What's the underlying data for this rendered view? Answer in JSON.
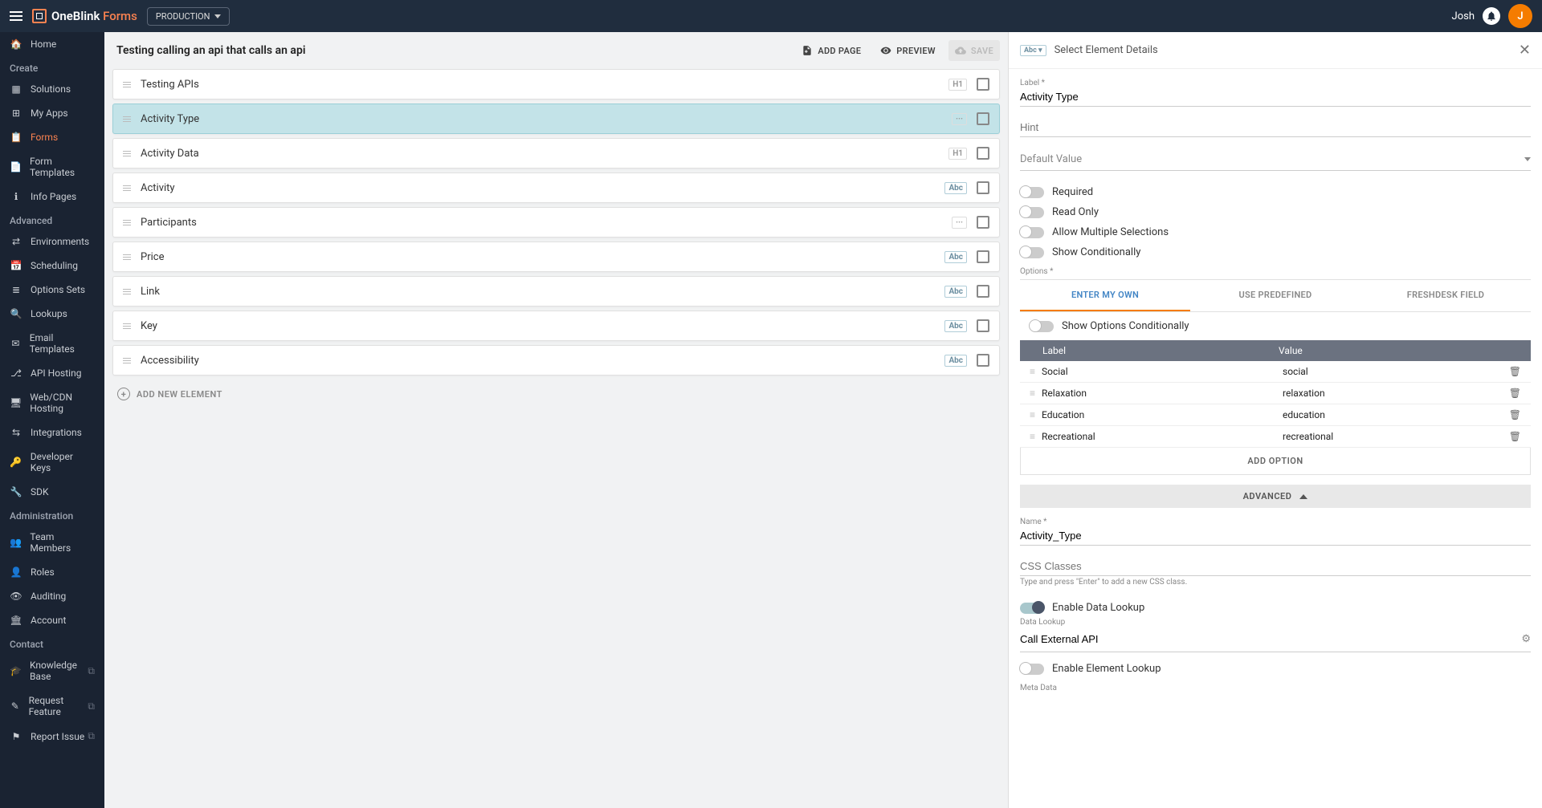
{
  "header": {
    "brand_one": "OneBlink",
    "brand_forms": "Forms",
    "env_btn": "PRODUCTION",
    "username": "Josh",
    "avatar_initial": "J"
  },
  "sidebar": {
    "home": "Home",
    "section_create": "Create",
    "create": [
      {
        "label": "Solutions"
      },
      {
        "label": "My Apps"
      },
      {
        "label": "Forms",
        "active": true
      },
      {
        "label": "Form Templates"
      },
      {
        "label": "Info Pages"
      }
    ],
    "section_advanced": "Advanced",
    "advanced": [
      {
        "label": "Environments"
      },
      {
        "label": "Scheduling"
      },
      {
        "label": "Options Sets"
      },
      {
        "label": "Lookups"
      },
      {
        "label": "Email Templates"
      },
      {
        "label": "API Hosting"
      },
      {
        "label": "Web/CDN Hosting"
      },
      {
        "label": "Integrations"
      },
      {
        "label": "Developer Keys"
      },
      {
        "label": "SDK"
      }
    ],
    "section_admin": "Administration",
    "admin": [
      {
        "label": "Team Members"
      },
      {
        "label": "Roles"
      },
      {
        "label": "Auditing"
      },
      {
        "label": "Account"
      }
    ],
    "section_contact": "Contact",
    "contact": [
      {
        "label": "Knowledge Base"
      },
      {
        "label": "Request Feature"
      },
      {
        "label": "Report Issue"
      }
    ]
  },
  "form": {
    "title": "Testing calling an api that calls an api",
    "add_page": "ADD PAGE",
    "preview": "PREVIEW",
    "save": "SAVE",
    "elements": [
      {
        "label": "Testing APIs",
        "tag": "H1"
      },
      {
        "label": "Activity Type",
        "tag": "···",
        "selected": true
      },
      {
        "label": "Activity Data",
        "tag": "H1"
      },
      {
        "label": "Activity",
        "tag": "Abc",
        "blue": true
      },
      {
        "label": "Participants",
        "tag": "···"
      },
      {
        "label": "Price",
        "tag": "Abc",
        "blue": true
      },
      {
        "label": "Link",
        "tag": "Abc",
        "blue": true
      },
      {
        "label": "Key",
        "tag": "Abc",
        "blue": true
      },
      {
        "label": "Accessibility",
        "tag": "Abc",
        "blue": true
      }
    ],
    "add_element": "ADD NEW ELEMENT"
  },
  "panel": {
    "title": "Select Element Details",
    "badge": "Abc ▾",
    "label_field": "Label *",
    "label_value": "Activity Type",
    "hint_field": "Hint",
    "default_field": "Default Value",
    "toggle_required": "Required",
    "toggle_readonly": "Read Only",
    "toggle_multi": "Allow Multiple Selections",
    "toggle_conditional": "Show Conditionally",
    "options_label": "Options *",
    "tabs": [
      "ENTER MY OWN",
      "USE PREDEFINED",
      "FRESHDESK FIELD"
    ],
    "toggle_opts_conditional": "Show Options Conditionally",
    "col_label": "Label",
    "col_value": "Value",
    "options": [
      {
        "label": "Social",
        "value": "social"
      },
      {
        "label": "Relaxation",
        "value": "relaxation"
      },
      {
        "label": "Education",
        "value": "education"
      },
      {
        "label": "Recreational",
        "value": "recreational"
      }
    ],
    "add_option": "ADD OPTION",
    "advanced": "ADVANCED",
    "name_field": "Name *",
    "name_value": "Activity_Type",
    "css_field": "CSS Classes",
    "css_hint": "Type and press \"Enter\" to add a new CSS class.",
    "toggle_data_lookup": "Enable Data Lookup",
    "data_lookup_label": "Data Lookup",
    "data_lookup_value": "Call External API",
    "toggle_element_lookup": "Enable Element Lookup",
    "meta_label": "Meta Data"
  }
}
